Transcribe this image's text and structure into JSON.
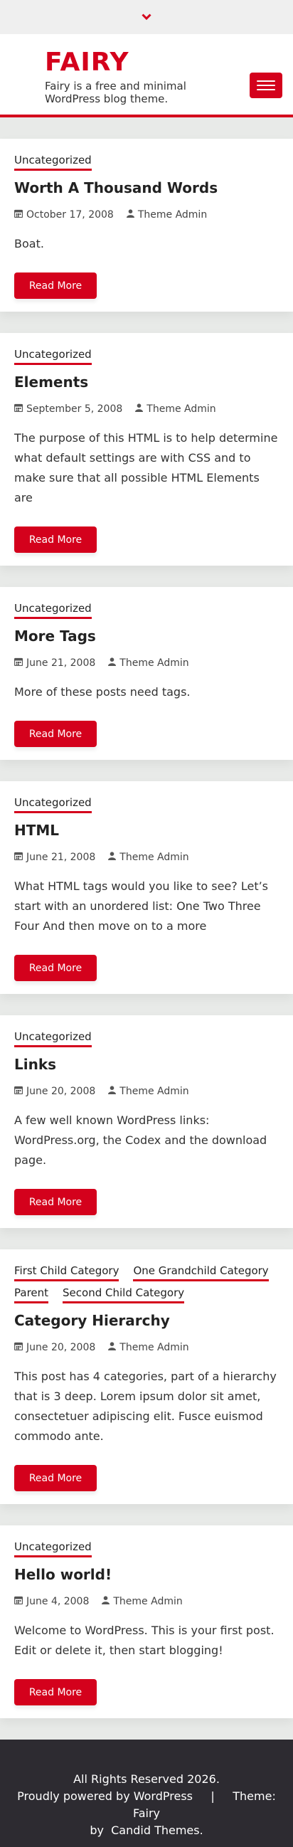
{
  "site": {
    "title": "FAIRY",
    "description": "Fairy is a free and minimal WordPress blog theme."
  },
  "colors": {
    "accent": "#d4011c",
    "footer": "#2d2b31",
    "background": "#e8eae8"
  },
  "posts": [
    {
      "categories": [
        "Uncategorized"
      ],
      "title": "Worth A Thousand Words",
      "date": "October 17, 2008",
      "author": "Theme Admin",
      "excerpt": "Boat.",
      "button": "Read More"
    },
    {
      "categories": [
        "Uncategorized"
      ],
      "title": "Elements",
      "date": "September 5, 2008",
      "author": "Theme Admin",
      "excerpt": "The purpose of this HTML is to help determine what default settings are with CSS and to make sure that all possible HTML Elements are",
      "button": "Read More"
    },
    {
      "categories": [
        "Uncategorized"
      ],
      "title": "More Tags",
      "date": "June 21, 2008",
      "author": "Theme Admin",
      "excerpt": "More of these posts need tags.",
      "button": "Read More"
    },
    {
      "categories": [
        "Uncategorized"
      ],
      "title": "HTML",
      "date": "June 21, 2008",
      "author": "Theme Admin",
      "excerpt": "What HTML tags would you like to see? Let’s start with an unordered list: One Two Three Four And then move on to a more",
      "button": "Read More"
    },
    {
      "categories": [
        "Uncategorized"
      ],
      "title": "Links",
      "date": "June 20, 2008",
      "author": "Theme Admin",
      "excerpt": "A few well known WordPress links: WordPress.org, the Codex and the download page.",
      "button": "Read More"
    },
    {
      "categories": [
        "First Child Category",
        "One Grandchild Category",
        "Parent",
        "Second Child Category"
      ],
      "title": "Category Hierarchy",
      "date": "June 20, 2008",
      "author": "Theme Admin",
      "excerpt": "This post has 4 categories, part of a hierarchy that is 3 deep. Lorem ipsum dolor sit amet, consectetuer adipiscing elit. Fusce euismod commodo ante.",
      "button": "Read More"
    },
    {
      "categories": [
        "Uncategorized"
      ],
      "title": "Hello world!",
      "date": "June 4, 2008",
      "author": "Theme Admin",
      "excerpt": "Welcome to WordPress. This is your first post. Edit or delete it, then start blogging!",
      "button": "Read More"
    }
  ],
  "footer": {
    "copyright": "All Rights Reserved 2026.",
    "powered": "Proudly powered by WordPress",
    "separator": "|",
    "theme_prefix": "Theme: Fairy",
    "by": "by",
    "author": "Candid Themes."
  },
  "icons": {
    "top": "chevron-down-icon",
    "date": "calendar-icon",
    "author": "user-icon",
    "menu": "hamburger-icon"
  }
}
